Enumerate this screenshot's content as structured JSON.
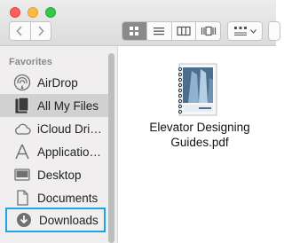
{
  "window": {
    "controls": [
      "close",
      "minimize",
      "maximize"
    ]
  },
  "toolbar": {
    "nav": [
      "back-icon",
      "forward-icon"
    ],
    "views": [
      "icon-view-icon",
      "list-view-icon",
      "column-view-icon",
      "cover-flow-icon"
    ],
    "active_view": "icon-view-icon",
    "arrange": "arrange-icon"
  },
  "sidebar": {
    "section_title": "Favorites",
    "items": [
      {
        "label": "AirDrop",
        "icon": "airdrop-icon"
      },
      {
        "label": "All My Files",
        "icon": "all-my-files-icon",
        "selected": true
      },
      {
        "label": "iCloud Dri…",
        "icon": "icloud-icon"
      },
      {
        "label": "Applicatio…",
        "icon": "applications-icon"
      },
      {
        "label": "Desktop",
        "icon": "desktop-icon"
      },
      {
        "label": "Documents",
        "icon": "documents-icon"
      },
      {
        "label": "Downloads",
        "icon": "downloads-icon",
        "highlighted": true
      }
    ]
  },
  "content": {
    "files": [
      {
        "name": "Elevator Designing Guides.pdf",
        "type": "pdf"
      }
    ]
  },
  "colors": {
    "highlight": "#1ea3e8",
    "selected_row": "#d1d1d1",
    "sidebar_bg": "#f0eeee"
  }
}
